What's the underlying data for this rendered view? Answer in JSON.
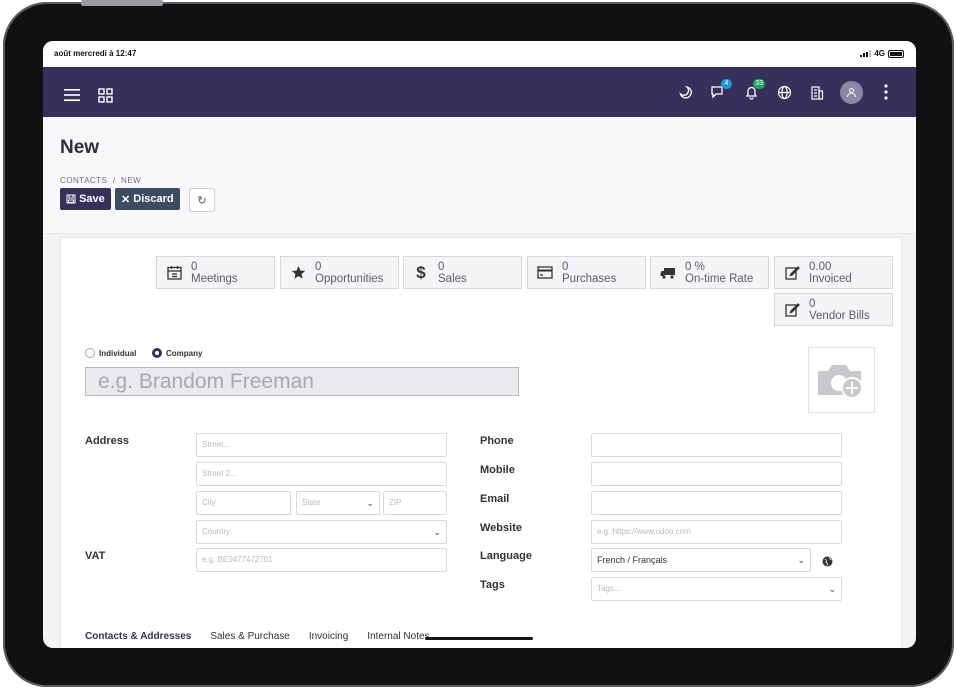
{
  "status_bar": {
    "time": "août mercredi à 12:47",
    "network": "4G"
  },
  "navbar": {
    "messages_badge": "4",
    "notifications_badge": "33"
  },
  "page": {
    "title": "New",
    "breadcrumb_root": "CONTACTS",
    "breadcrumb_sep": "/",
    "breadcrumb_current": "NEW",
    "save_label": "Save",
    "discard_label": "Discard"
  },
  "stats": [
    {
      "value": "0",
      "label": "Meetings",
      "icon": "calendar-icon"
    },
    {
      "value": "0",
      "label": "Opportunities",
      "icon": "star-icon"
    },
    {
      "value": "0",
      "label": "Sales",
      "icon": "dollar-icon"
    },
    {
      "value": "0",
      "label": "Purchases",
      "icon": "credit-card-icon"
    },
    {
      "value": "0 %",
      "label": "On-time Rate",
      "icon": "truck-icon"
    },
    {
      "value": "0.00",
      "label": "Invoiced",
      "icon": "edit-icon"
    },
    {
      "value": "0",
      "label": "Vendor Bills",
      "icon": "edit-icon"
    }
  ],
  "form": {
    "type_individual": "Individual",
    "type_company": "Company",
    "name_placeholder": "e.g. Brandom Freeman",
    "address_label": "Address",
    "street_placeholder": "Street...",
    "street2_placeholder": "Street 2...",
    "city_placeholder": "City",
    "state_placeholder": "State",
    "zip_placeholder": "ZIP",
    "country_placeholder": "Country",
    "vat_label": "VAT",
    "vat_placeholder": "e.g. BE0477472701",
    "phone_label": "Phone",
    "mobile_label": "Mobile",
    "email_label": "Email",
    "website_label": "Website",
    "website_placeholder": "e.g. https://www.odoo.com",
    "language_label": "Language",
    "language_value": "French / Français",
    "tags_label": "Tags",
    "tags_placeholder": "Tags..."
  },
  "tabs": [
    "Contacts & Addresses",
    "Sales & Purchase",
    "Invoicing",
    "Internal Notes"
  ],
  "colors": {
    "navbar": "#35315b",
    "accent": "#35315b",
    "badge_blue": "#1b9ae0",
    "badge_green": "#1aa75f"
  }
}
